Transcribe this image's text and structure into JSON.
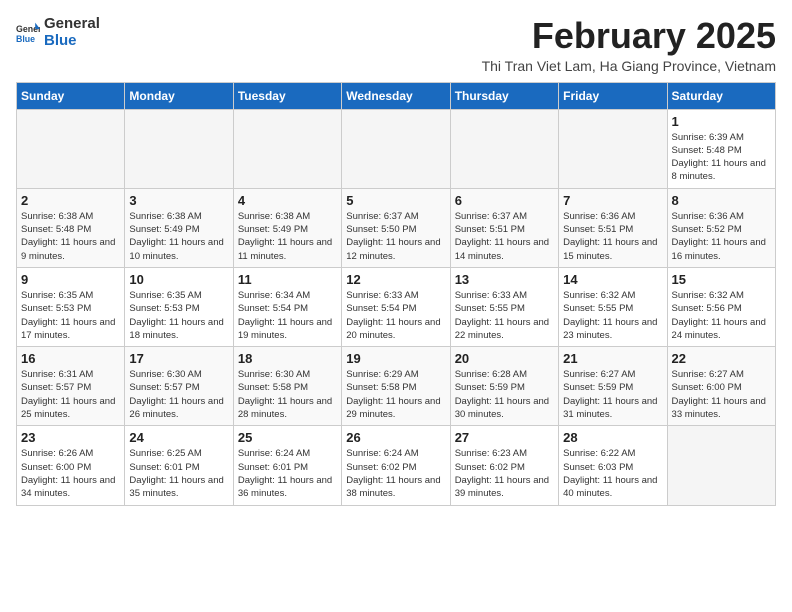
{
  "header": {
    "logo_general": "General",
    "logo_blue": "Blue",
    "month_title": "February 2025",
    "location": "Thi Tran Viet Lam, Ha Giang Province, Vietnam"
  },
  "weekdays": [
    "Sunday",
    "Monday",
    "Tuesday",
    "Wednesday",
    "Thursday",
    "Friday",
    "Saturday"
  ],
  "weeks": [
    [
      {
        "day": "",
        "info": ""
      },
      {
        "day": "",
        "info": ""
      },
      {
        "day": "",
        "info": ""
      },
      {
        "day": "",
        "info": ""
      },
      {
        "day": "",
        "info": ""
      },
      {
        "day": "",
        "info": ""
      },
      {
        "day": "1",
        "info": "Sunrise: 6:39 AM\nSunset: 5:48 PM\nDaylight: 11 hours and 8 minutes."
      }
    ],
    [
      {
        "day": "2",
        "info": "Sunrise: 6:38 AM\nSunset: 5:48 PM\nDaylight: 11 hours and 9 minutes."
      },
      {
        "day": "3",
        "info": "Sunrise: 6:38 AM\nSunset: 5:49 PM\nDaylight: 11 hours and 10 minutes."
      },
      {
        "day": "4",
        "info": "Sunrise: 6:38 AM\nSunset: 5:49 PM\nDaylight: 11 hours and 11 minutes."
      },
      {
        "day": "5",
        "info": "Sunrise: 6:37 AM\nSunset: 5:50 PM\nDaylight: 11 hours and 12 minutes."
      },
      {
        "day": "6",
        "info": "Sunrise: 6:37 AM\nSunset: 5:51 PM\nDaylight: 11 hours and 14 minutes."
      },
      {
        "day": "7",
        "info": "Sunrise: 6:36 AM\nSunset: 5:51 PM\nDaylight: 11 hours and 15 minutes."
      },
      {
        "day": "8",
        "info": "Sunrise: 6:36 AM\nSunset: 5:52 PM\nDaylight: 11 hours and 16 minutes."
      }
    ],
    [
      {
        "day": "9",
        "info": "Sunrise: 6:35 AM\nSunset: 5:53 PM\nDaylight: 11 hours and 17 minutes."
      },
      {
        "day": "10",
        "info": "Sunrise: 6:35 AM\nSunset: 5:53 PM\nDaylight: 11 hours and 18 minutes."
      },
      {
        "day": "11",
        "info": "Sunrise: 6:34 AM\nSunset: 5:54 PM\nDaylight: 11 hours and 19 minutes."
      },
      {
        "day": "12",
        "info": "Sunrise: 6:33 AM\nSunset: 5:54 PM\nDaylight: 11 hours and 20 minutes."
      },
      {
        "day": "13",
        "info": "Sunrise: 6:33 AM\nSunset: 5:55 PM\nDaylight: 11 hours and 22 minutes."
      },
      {
        "day": "14",
        "info": "Sunrise: 6:32 AM\nSunset: 5:55 PM\nDaylight: 11 hours and 23 minutes."
      },
      {
        "day": "15",
        "info": "Sunrise: 6:32 AM\nSunset: 5:56 PM\nDaylight: 11 hours and 24 minutes."
      }
    ],
    [
      {
        "day": "16",
        "info": "Sunrise: 6:31 AM\nSunset: 5:57 PM\nDaylight: 11 hours and 25 minutes."
      },
      {
        "day": "17",
        "info": "Sunrise: 6:30 AM\nSunset: 5:57 PM\nDaylight: 11 hours and 26 minutes."
      },
      {
        "day": "18",
        "info": "Sunrise: 6:30 AM\nSunset: 5:58 PM\nDaylight: 11 hours and 28 minutes."
      },
      {
        "day": "19",
        "info": "Sunrise: 6:29 AM\nSunset: 5:58 PM\nDaylight: 11 hours and 29 minutes."
      },
      {
        "day": "20",
        "info": "Sunrise: 6:28 AM\nSunset: 5:59 PM\nDaylight: 11 hours and 30 minutes."
      },
      {
        "day": "21",
        "info": "Sunrise: 6:27 AM\nSunset: 5:59 PM\nDaylight: 11 hours and 31 minutes."
      },
      {
        "day": "22",
        "info": "Sunrise: 6:27 AM\nSunset: 6:00 PM\nDaylight: 11 hours and 33 minutes."
      }
    ],
    [
      {
        "day": "23",
        "info": "Sunrise: 6:26 AM\nSunset: 6:00 PM\nDaylight: 11 hours and 34 minutes."
      },
      {
        "day": "24",
        "info": "Sunrise: 6:25 AM\nSunset: 6:01 PM\nDaylight: 11 hours and 35 minutes."
      },
      {
        "day": "25",
        "info": "Sunrise: 6:24 AM\nSunset: 6:01 PM\nDaylight: 11 hours and 36 minutes."
      },
      {
        "day": "26",
        "info": "Sunrise: 6:24 AM\nSunset: 6:02 PM\nDaylight: 11 hours and 38 minutes."
      },
      {
        "day": "27",
        "info": "Sunrise: 6:23 AM\nSunset: 6:02 PM\nDaylight: 11 hours and 39 minutes."
      },
      {
        "day": "28",
        "info": "Sunrise: 6:22 AM\nSunset: 6:03 PM\nDaylight: 11 hours and 40 minutes."
      },
      {
        "day": "",
        "info": ""
      }
    ]
  ]
}
